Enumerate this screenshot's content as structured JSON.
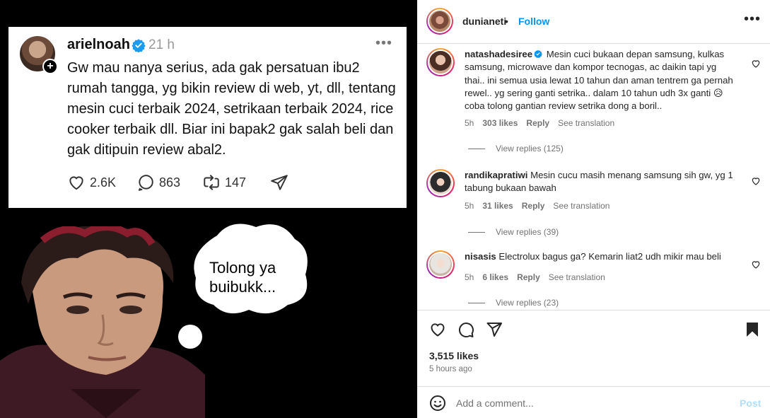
{
  "post_image": {
    "tweet": {
      "username": "arielnoah",
      "time": "21 h",
      "more": "•••",
      "body": "Gw mau nanya serius, ada gak persatuan ibu2 rumah tangga, yg bikin review di web, yt, dll, tentang mesin cuci terbaik 2024, setrikaan terbaik 2024, rice cooker terbaik dll. Biar ini bapak2 gak salah beli dan gak ditipuin review abal2.",
      "likes": "2.6K",
      "replies": "863",
      "reposts": "147"
    },
    "bubble_text_line1": "Tolong ya",
    "bubble_text_line2": "buibukk..."
  },
  "header": {
    "username": "dunianeti",
    "dot": "•",
    "follow_label": "Follow",
    "more": "•••"
  },
  "comments": [
    {
      "username": "natashadesiree",
      "verified": true,
      "text": "Mesin cuci bukaan depan samsung, kulkas samsung, microwave dan kompor tecnogas, ac daikin tapi yg thai.. ini semua usia lewat 10 tahun dan aman tentrem ga pernah rewel.. yg sering ganti setrika.. dalam 10 tahun udh 3x ganti 😥 coba tolong gantian review setrika dong a boril..",
      "time": "5h",
      "likes": "303 likes",
      "reply": "Reply",
      "translate": "See translation",
      "view_replies": "View replies (125)"
    },
    {
      "username": "randikapratiwi",
      "verified": false,
      "text": "Mesin cucu masih menang samsung sih gw, yg 1 tabung bukaan bawah",
      "time": "5h",
      "likes": "31 likes",
      "reply": "Reply",
      "translate": "See translation",
      "view_replies": "View replies (39)"
    },
    {
      "username": "nisasis",
      "verified": false,
      "text": "Electrolux bagus ga? Kemarin liat2 udh mikir mau beli",
      "time": "5h",
      "likes": "6 likes",
      "reply": "Reply",
      "translate": "See translation",
      "view_replies": "View replies (23)"
    }
  ],
  "actions": {
    "likes": "3,515 likes",
    "ago": "5 hours ago"
  },
  "add_comment": {
    "placeholder": "Add a comment...",
    "post_label": "Post"
  },
  "colors": {
    "accent": "#0095f6",
    "post_disabled": "#b2dffc",
    "secondary_text": "#737373",
    "verified": "#0095f6"
  },
  "icons": [
    "verified-badge-icon",
    "heart-icon",
    "comment-icon",
    "repost-icon",
    "share-icon",
    "bookmark-icon",
    "emoji-icon",
    "more-icon"
  ]
}
